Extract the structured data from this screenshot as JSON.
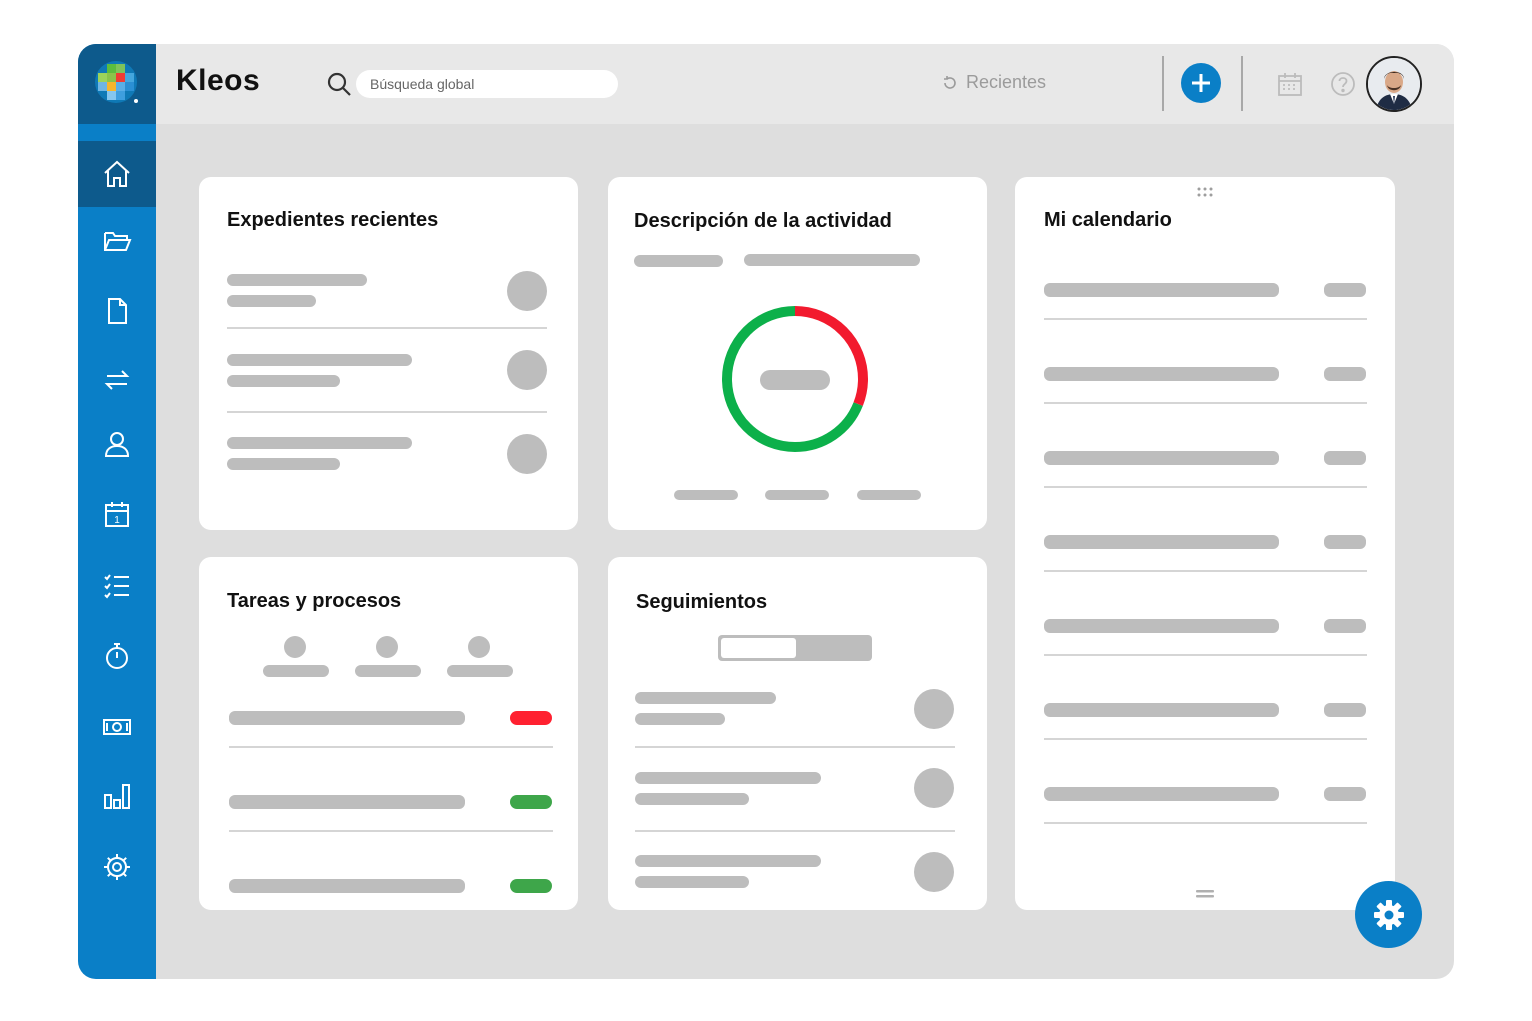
{
  "app": {
    "brand": "Kleos"
  },
  "header": {
    "search_placeholder": "Búsqueda global",
    "recent_label": "Recientes"
  },
  "sidebar": {
    "items": [
      {
        "icon": "home-icon",
        "active": true
      },
      {
        "icon": "folder-icon"
      },
      {
        "icon": "document-icon"
      },
      {
        "icon": "transfer-arrows-icon"
      },
      {
        "icon": "user-icon"
      },
      {
        "icon": "calendar-icon",
        "badge_text": "1"
      },
      {
        "icon": "checklist-icon"
      },
      {
        "icon": "stopwatch-icon"
      },
      {
        "icon": "money-icon"
      },
      {
        "icon": "bar-chart-icon"
      },
      {
        "icon": "settings-gear-icon"
      }
    ]
  },
  "widgets": {
    "recent_files": {
      "title": "Expedientes recientes"
    },
    "activity": {
      "title": "Descripción de la actividad",
      "donut": {
        "green_fraction": 0.69,
        "red_fraction": 0.31
      }
    },
    "calendar": {
      "title": "Mi calendario"
    },
    "tasks": {
      "title": "Tareas y procesos",
      "status_colors": [
        "#ff2130",
        "#3ea64a",
        "#3ea64a"
      ]
    },
    "followups": {
      "title": "Seguimientos"
    }
  },
  "colors": {
    "brand_blue": "#0a7fc7",
    "brand_dark_blue": "#0d5a8c",
    "status_red": "#ff2130",
    "status_green": "#3ea64a",
    "donut_green": "#0cb04a",
    "donut_red": "#f21a2e"
  }
}
